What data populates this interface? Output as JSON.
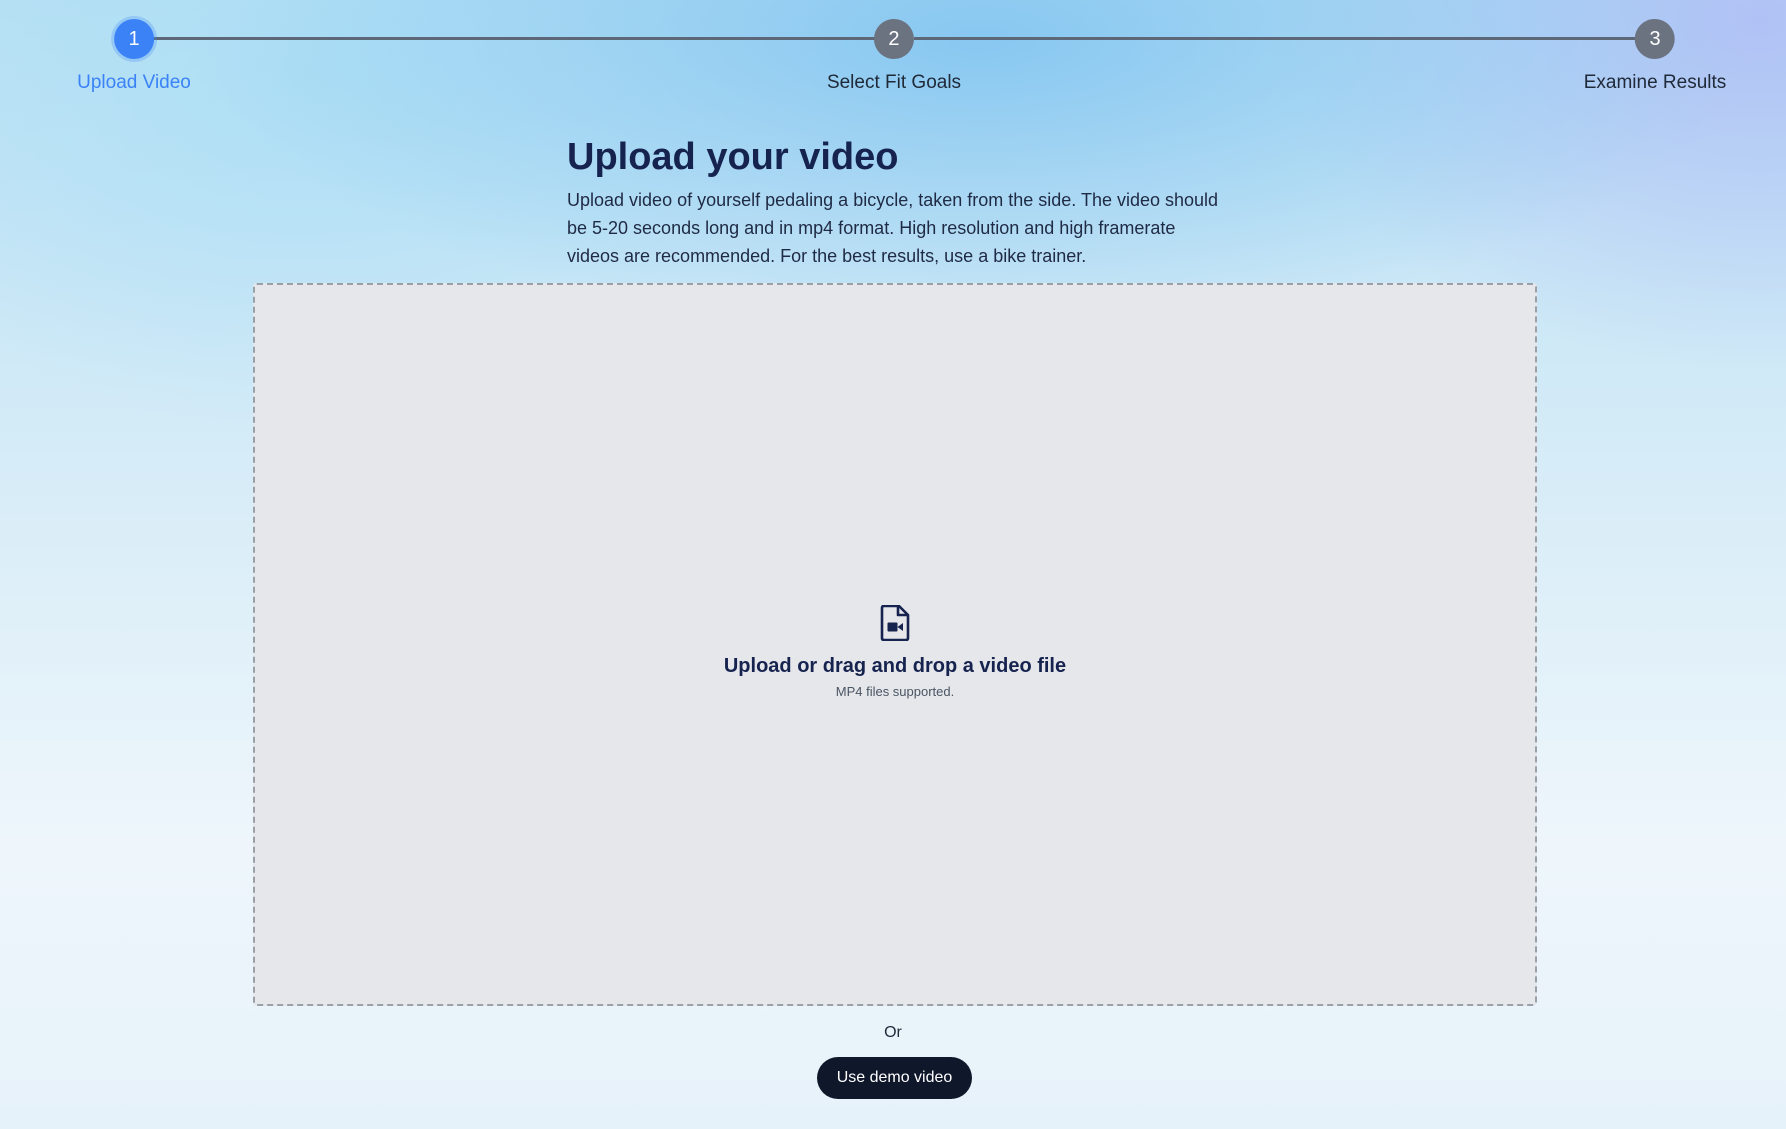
{
  "stepper": {
    "steps": [
      {
        "number": "1",
        "label": "Upload Video",
        "active": true
      },
      {
        "number": "2",
        "label": "Select Fit Goals",
        "active": false
      },
      {
        "number": "3",
        "label": "Examine Results",
        "active": false
      }
    ],
    "active_color": "#3b82f6",
    "inactive_color": "#6b7280"
  },
  "intro": {
    "title": "Upload your video",
    "description": "Upload video of yourself pedaling a bicycle, taken from the side. The video should be 5-20 seconds long and in mp4 format. High resolution and high framerate videos are recommended. For the best results, use a bike trainer."
  },
  "dropzone": {
    "icon": "video-file-icon",
    "title": "Upload or drag and drop a video file",
    "subtitle": "MP4 files supported."
  },
  "alternative": {
    "or_text": "Or",
    "demo_button_label": "Use demo video"
  }
}
